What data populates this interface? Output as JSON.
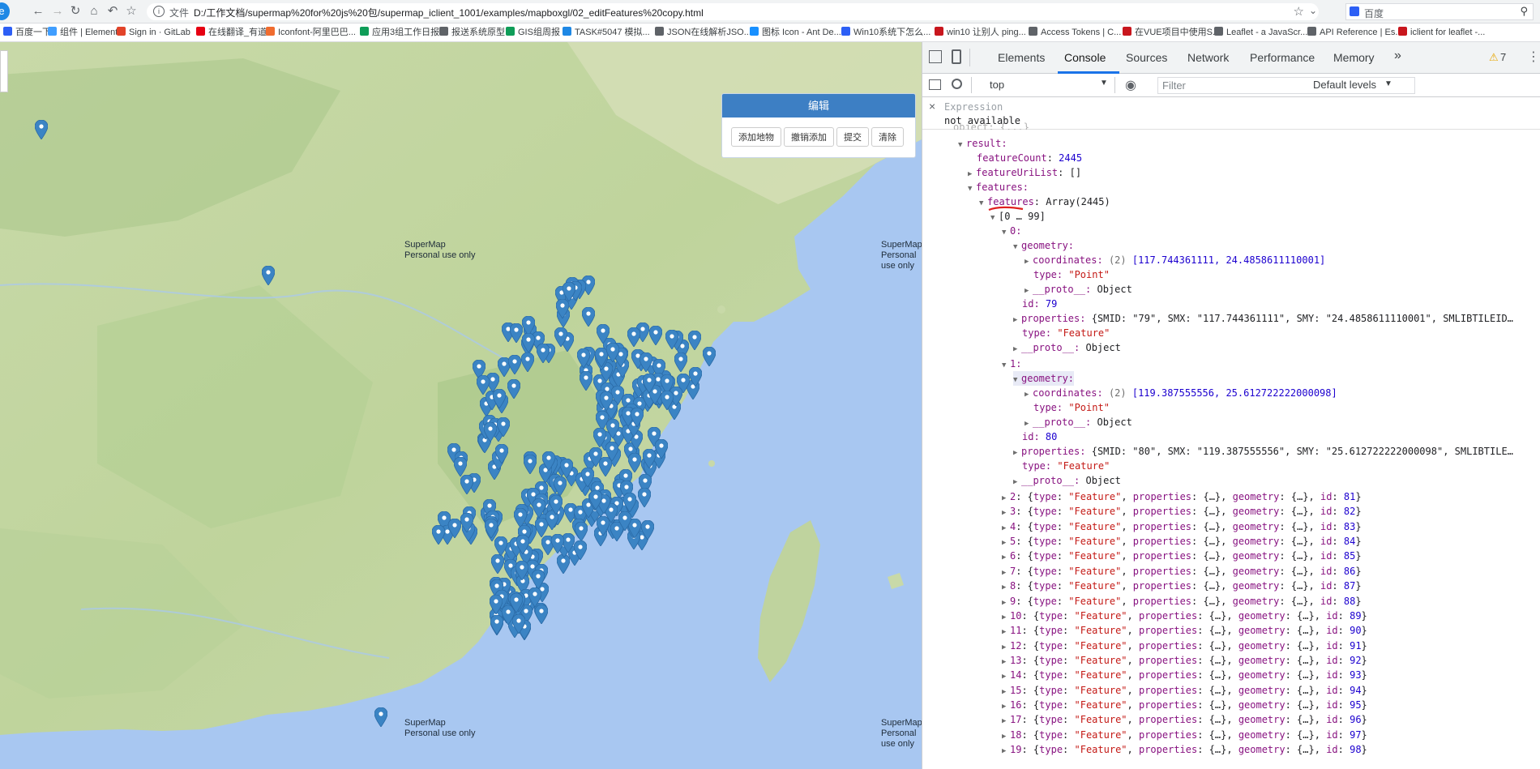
{
  "browser": {
    "protocol_label": "文件",
    "url": "D:/工作文档/supermap%20for%20js%20包/supermap_iclient_1001/examples/mapboxgl/02_editFeatures%20copy.html",
    "search_placeholder": "百度"
  },
  "bookmarks": [
    {
      "label": "百度一下",
      "color": "#2d5ff5"
    },
    {
      "label": "组件 | Element",
      "color": "#409eff"
    },
    {
      "label": "Sign in · GitLab",
      "color": "#e24329"
    },
    {
      "label": "在线翻译_有道",
      "color": "#e60012"
    },
    {
      "label": "Iconfont-阿里巴巴...",
      "color": "#f06c2f"
    },
    {
      "label": "应用3组工作日报",
      "color": "#0f9d58"
    },
    {
      "label": "报送系统原型",
      "color": "#5f6368"
    },
    {
      "label": "GIS组周报",
      "color": "#0f9d58"
    },
    {
      "label": "TASK#5047 模拟...",
      "color": "#1e88e5"
    },
    {
      "label": "JSON在线解析JSO...",
      "color": "#5f6368"
    },
    {
      "label": "图标 Icon - Ant De...",
      "color": "#1890ff"
    },
    {
      "label": "Win10系统下怎么...",
      "color": "#2d5ff5"
    },
    {
      "label": "win10 让别人 ping...",
      "color": "#c8161d"
    },
    {
      "label": "Access Tokens | C...",
      "color": "#5f6368"
    },
    {
      "label": "在VUE项目中使用S...",
      "color": "#c8161d"
    },
    {
      "label": "Leaflet - a JavaScr...",
      "color": "#5f6368"
    },
    {
      "label": "API Reference | Es...",
      "color": "#5f6368"
    },
    {
      "label": "iclient for leaflet -...",
      "color": "#c8161d"
    }
  ],
  "map": {
    "watermark_line1": "SuperMap",
    "watermark_line2": "Personal use only",
    "pin_color": "#3b84c4"
  },
  "edit_panel": {
    "title": "编辑",
    "buttons": [
      "添加地物",
      "撤销添加",
      "提交",
      "清除"
    ]
  },
  "devtools": {
    "tabs": [
      "Elements",
      "Console",
      "Sources",
      "Network",
      "Performance",
      "Memory"
    ],
    "active_tab": "Console",
    "more_tabs": "»",
    "warning_count": "7",
    "context": "top",
    "filter_placeholder": "Filter",
    "levels": "Default levels",
    "expression_label": "Expression",
    "expression_value": "not available"
  },
  "console_tree": {
    "result_key": "result:",
    "feature_count_key": "featureCount",
    "feature_count": "2445",
    "feature_uri_key": "featureUriList",
    "feature_uri_val": "[]",
    "features_key": "features:",
    "features_arr_key": "features",
    "features_arr_val": "Array(2445)",
    "range": "[0 … 99]",
    "items": [
      {
        "index": "0",
        "coordinates": "[117.744361111, 24.4858611110001]",
        "coord_count": "(2)",
        "type": "\"Point\"",
        "id": "79",
        "props": "{SMID: \"79\", SMX: \"117.744361111\", SMY: \"24.4858611110001\", SMLIBTILEID…"
      },
      {
        "index": "1",
        "coordinates": "[119.387555556, 25.612722222000098]",
        "coord_count": "(2)",
        "type": "\"Point\"",
        "id": "80",
        "props": "{SMID: \"80\", SMX: \"119.387555556\", SMY: \"25.612722222000098\", SMLIBTILE…"
      }
    ],
    "labels": {
      "geometry": "geometry:",
      "coordinates": "coordinates:",
      "type": "type:",
      "proto": "__proto__:",
      "object": "Object",
      "id": "id:",
      "properties": "properties:",
      "feature": "\"Feature\""
    },
    "collapsed": [
      {
        "index": "2",
        "id": "81"
      },
      {
        "index": "3",
        "id": "82"
      },
      {
        "index": "4",
        "id": "83"
      },
      {
        "index": "5",
        "id": "84"
      },
      {
        "index": "6",
        "id": "85"
      },
      {
        "index": "7",
        "id": "86"
      },
      {
        "index": "8",
        "id": "87"
      },
      {
        "index": "9",
        "id": "88"
      },
      {
        "index": "10",
        "id": "89"
      },
      {
        "index": "11",
        "id": "90"
      },
      {
        "index": "12",
        "id": "91"
      },
      {
        "index": "13",
        "id": "92"
      },
      {
        "index": "14",
        "id": "93"
      },
      {
        "index": "15",
        "id": "94"
      },
      {
        "index": "16",
        "id": "95"
      },
      {
        "index": "17",
        "id": "96"
      },
      {
        "index": "18",
        "id": "97"
      },
      {
        "index": "19",
        "id": "98"
      }
    ]
  }
}
